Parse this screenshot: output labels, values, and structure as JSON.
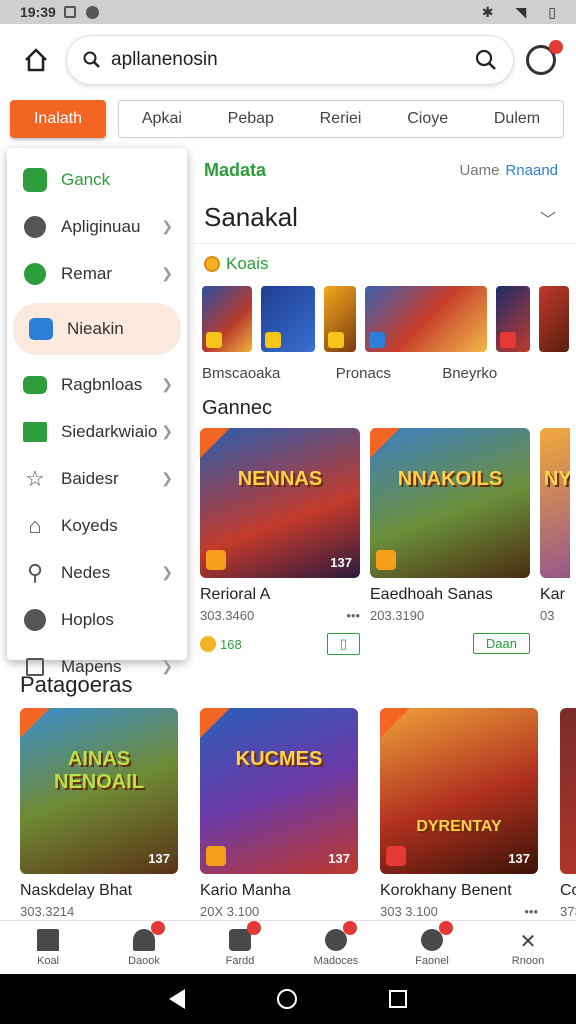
{
  "status_bar": {
    "time": "19:39"
  },
  "search": {
    "value": "apllanenosin"
  },
  "tabs": {
    "active": "Inalath",
    "items": [
      "Apkai",
      "Pebap",
      "Reriei",
      "Cioye",
      "Dulem"
    ]
  },
  "side_menu": {
    "items": [
      {
        "label": "Ganck",
        "icon": "game-icon"
      },
      {
        "label": "Apliginuau",
        "icon": "apps-icon"
      },
      {
        "label": "Remar",
        "icon": "check-icon"
      },
      {
        "label": "Nieakin",
        "icon": "controller-icon"
      },
      {
        "label": "Ragbnloas",
        "icon": "minus-icon"
      },
      {
        "label": "Siedarkwiaio",
        "icon": "folder-icon"
      },
      {
        "label": "Baidesr",
        "icon": "star-icon"
      },
      {
        "label": "Koyeds",
        "icon": "bag-icon"
      },
      {
        "label": "Nedes",
        "icon": "search-icon"
      },
      {
        "label": "Hoplos",
        "icon": "compass-icon"
      },
      {
        "label": "Mapens",
        "icon": "export-icon"
      }
    ]
  },
  "content": {
    "madata": "Madata",
    "uame": "Uame",
    "link": "Rnaand",
    "sanakal": "Sanakal",
    "koais": "Koais",
    "category_labels": [
      "Bmscaoaka",
      "Pronacs",
      "Bneyrko"
    ],
    "games_title": "Gannec",
    "cards": [
      {
        "title": "NENNAS",
        "name": "Rerioral A",
        "meta": "303.3460",
        "count": "137",
        "points": "168"
      },
      {
        "title": "NNAKOILS",
        "name": "Eaedhoah Sanas",
        "meta": "203.3190",
        "count": "",
        "button": "Daan"
      },
      {
        "title": "NY",
        "name": "Kar",
        "meta": "03",
        "count": ""
      }
    ]
  },
  "bottom": {
    "title": "Patagoeras",
    "cards": [
      {
        "title": "AINAS NENOAIL",
        "name": "Naskdelay Bhat",
        "meta": "303.3214",
        "count": "137"
      },
      {
        "title": "KUCMES",
        "name": "Kario Manha",
        "meta": "20X 3.100",
        "count": "137"
      },
      {
        "title": "DYRENTAY",
        "name": "Korokhany Benent",
        "meta": "303 3.100",
        "count": "137"
      },
      {
        "title": "",
        "name": "Cor",
        "meta": "373",
        "count": ""
      }
    ]
  },
  "bottom_nav": [
    {
      "label": "Koal",
      "badge": false
    },
    {
      "label": "Daook",
      "badge": true
    },
    {
      "label": "Fardd",
      "badge": true
    },
    {
      "label": "Madoces",
      "badge": true
    },
    {
      "label": "Faonel",
      "badge": true
    },
    {
      "label": "Rnoon",
      "badge": false
    }
  ],
  "colors": {
    "accent": "#f26522",
    "green": "#2e9d3c",
    "link": "#2b7fd8"
  }
}
